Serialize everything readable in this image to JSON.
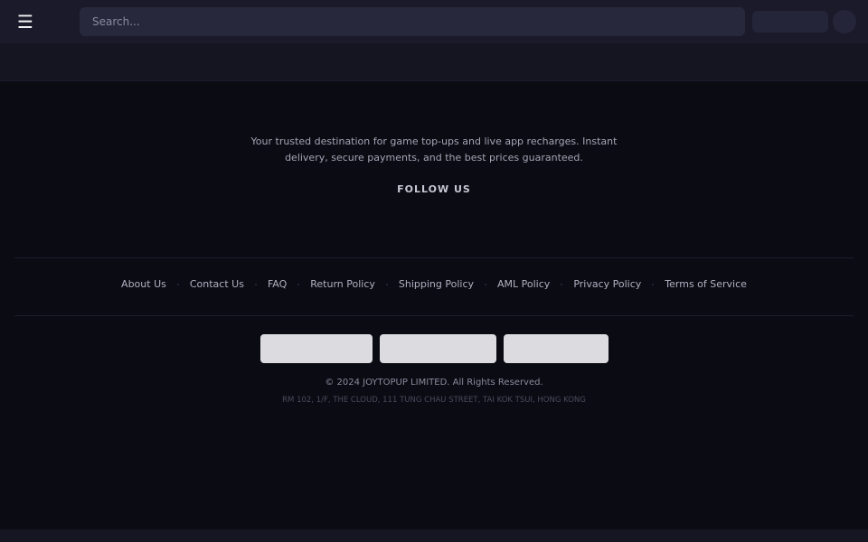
{
  "header": {
    "menu_icon": "hamburger-menu-icon",
    "search_placeholder": "Search..."
  },
  "footer": {
    "tagline": "Your trusted destination for game top-ups and live app recharges. Instant delivery, secure payments, and the best prices guaranteed.",
    "follow_title": "FOLLOW US",
    "links": [
      {
        "label": "About Us"
      },
      {
        "label": "Contact Us"
      },
      {
        "label": "FAQ"
      },
      {
        "label": "Return Policy"
      },
      {
        "label": "Shipping Policy"
      },
      {
        "label": "AML Policy"
      },
      {
        "label": "Privacy Policy"
      },
      {
        "label": "Terms of Service"
      }
    ],
    "copyright": "© 2024 JOYTOPUP LIMITED. All Rights Reserved.",
    "address": "RM 102, 1/F, THE CLOUD, 111 TUNG CHAU STREET, TAI KOK TSUI, HONG KONG"
  }
}
